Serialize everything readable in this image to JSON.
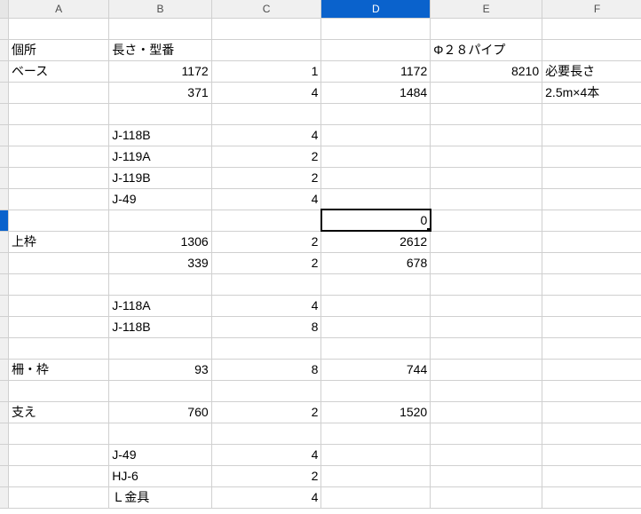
{
  "columns": [
    "A",
    "B",
    "C",
    "D",
    "E",
    "F"
  ],
  "selected_col": "D",
  "selected_row": 9,
  "active_cell_value": "0",
  "rows": [
    {
      "r": 1,
      "cells": {}
    },
    {
      "r": 2,
      "cells": {
        "A": {
          "v": "個所",
          "t": "txt"
        },
        "B": {
          "v": "長さ・型番",
          "t": "txt"
        },
        "E": {
          "v": "Φ２８パイプ",
          "t": "txt"
        }
      }
    },
    {
      "r": 3,
      "cells": {
        "A": {
          "v": "ベース",
          "t": "txt"
        },
        "B": {
          "v": "1172",
          "t": "num"
        },
        "C": {
          "v": "1",
          "t": "num"
        },
        "D": {
          "v": "1172",
          "t": "num"
        },
        "E": {
          "v": "8210",
          "t": "num"
        },
        "F": {
          "v": "必要長さ",
          "t": "txt"
        }
      }
    },
    {
      "r": 4,
      "cells": {
        "B": {
          "v": "371",
          "t": "num"
        },
        "C": {
          "v": "4",
          "t": "num"
        },
        "D": {
          "v": "1484",
          "t": "num"
        },
        "F": {
          "v": "2.5m×4本",
          "t": "txt"
        }
      }
    },
    {
      "r": 5,
      "cells": {}
    },
    {
      "r": 6,
      "cells": {
        "B": {
          "v": "J-118B",
          "t": "txt"
        },
        "C": {
          "v": "4",
          "t": "num"
        }
      }
    },
    {
      "r": 7,
      "cells": {
        "B": {
          "v": "J-119A",
          "t": "txt"
        },
        "C": {
          "v": "2",
          "t": "num"
        }
      }
    },
    {
      "r": 8,
      "cells": {
        "B": {
          "v": "J-119B",
          "t": "txt"
        },
        "C": {
          "v": "2",
          "t": "num"
        }
      }
    },
    {
      "r": 9,
      "cells": {
        "B": {
          "v": "J-49",
          "t": "txt"
        },
        "C": {
          "v": "4",
          "t": "num"
        }
      }
    },
    {
      "r": 10,
      "cells": {
        "D": {
          "v": "0",
          "t": "num",
          "active": true
        }
      }
    },
    {
      "r": 11,
      "cells": {
        "A": {
          "v": "上枠",
          "t": "txt"
        },
        "B": {
          "v": "1306",
          "t": "num"
        },
        "C": {
          "v": "2",
          "t": "num"
        },
        "D": {
          "v": "2612",
          "t": "num"
        }
      }
    },
    {
      "r": 12,
      "cells": {
        "B": {
          "v": "339",
          "t": "num"
        },
        "C": {
          "v": "2",
          "t": "num"
        },
        "D": {
          "v": "678",
          "t": "num"
        }
      }
    },
    {
      "r": 13,
      "cells": {}
    },
    {
      "r": 14,
      "cells": {
        "B": {
          "v": "J-118A",
          "t": "txt"
        },
        "C": {
          "v": "4",
          "t": "num"
        }
      }
    },
    {
      "r": 15,
      "cells": {
        "B": {
          "v": "J-118B",
          "t": "txt"
        },
        "C": {
          "v": "8",
          "t": "num"
        }
      }
    },
    {
      "r": 16,
      "cells": {}
    },
    {
      "r": 17,
      "cells": {
        "A": {
          "v": "柵・枠",
          "t": "txt"
        },
        "B": {
          "v": "93",
          "t": "num"
        },
        "C": {
          "v": "8",
          "t": "num"
        },
        "D": {
          "v": "744",
          "t": "num"
        }
      }
    },
    {
      "r": 18,
      "cells": {}
    },
    {
      "r": 19,
      "cells": {
        "A": {
          "v": "支え",
          "t": "txt"
        },
        "B": {
          "v": "760",
          "t": "num"
        },
        "C": {
          "v": "2",
          "t": "num"
        },
        "D": {
          "v": "1520",
          "t": "num"
        }
      }
    },
    {
      "r": 20,
      "cells": {}
    },
    {
      "r": 21,
      "cells": {
        "B": {
          "v": "J-49",
          "t": "txt"
        },
        "C": {
          "v": "4",
          "t": "num"
        }
      }
    },
    {
      "r": 22,
      "cells": {
        "B": {
          "v": "HJ-6",
          "t": "txt"
        },
        "C": {
          "v": "2",
          "t": "num"
        }
      }
    },
    {
      "r": 23,
      "cells": {
        "B": {
          "v": "Ｌ金具",
          "t": "txt"
        },
        "C": {
          "v": "4",
          "t": "num"
        }
      }
    }
  ]
}
